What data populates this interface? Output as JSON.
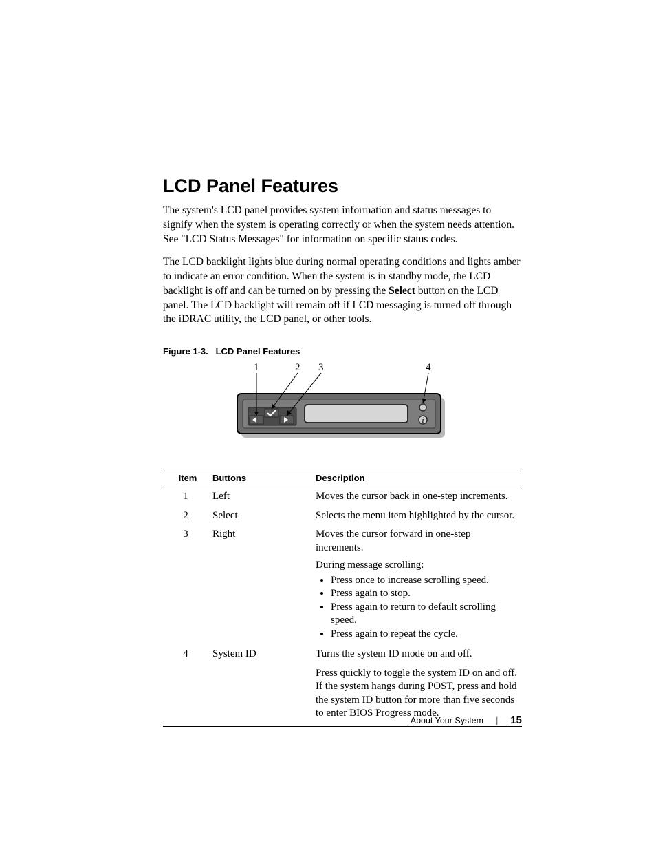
{
  "heading": "LCD Panel Features",
  "paragraphs": {
    "p1": "The system's LCD panel provides system information and status messages to signify when the system is operating correctly or when the system needs attention. See \"LCD Status Messages\" for information on specific status codes.",
    "p2a": "The LCD backlight lights blue during normal operating conditions and lights amber to indicate an error condition. When the system is in standby mode, the LCD backlight is off and can be turned on by pressing the ",
    "p2bold": "Select",
    "p2b": " button on the LCD panel. The LCD backlight will remain off if LCD messaging is turned off through the iDRAC utility, the LCD panel, or other tools."
  },
  "figure": {
    "caption_label": "Figure 1-3.",
    "caption_title": "LCD Panel Features",
    "callouts": [
      "1",
      "2",
      "3",
      "4"
    ]
  },
  "table": {
    "headers": {
      "item": "Item",
      "buttons": "Buttons",
      "description": "Description"
    },
    "rows": [
      {
        "item": "1",
        "button": "Left",
        "desc": "Moves the cursor back in one-step increments."
      },
      {
        "item": "2",
        "button": "Select",
        "desc": "Selects the menu item highlighted by the cursor."
      },
      {
        "item": "3",
        "button": "Right",
        "desc": "Moves the cursor forward in one-step increments.",
        "extra_heading": "During message scrolling:",
        "bullets": [
          "Press once to increase scrolling speed.",
          "Press again to stop.",
          "Press again to return to default scrolling speed.",
          "Press again to repeat the cycle."
        ]
      },
      {
        "item": "4",
        "button": "System ID",
        "desc": "Turns the system ID mode on and off.",
        "extra": "Press quickly to toggle the system ID on and off. If the system hangs during POST, press and hold the system ID button for more than five seconds to enter BIOS Progress mode."
      }
    ]
  },
  "footer": {
    "section": "About Your System",
    "page": "15"
  }
}
